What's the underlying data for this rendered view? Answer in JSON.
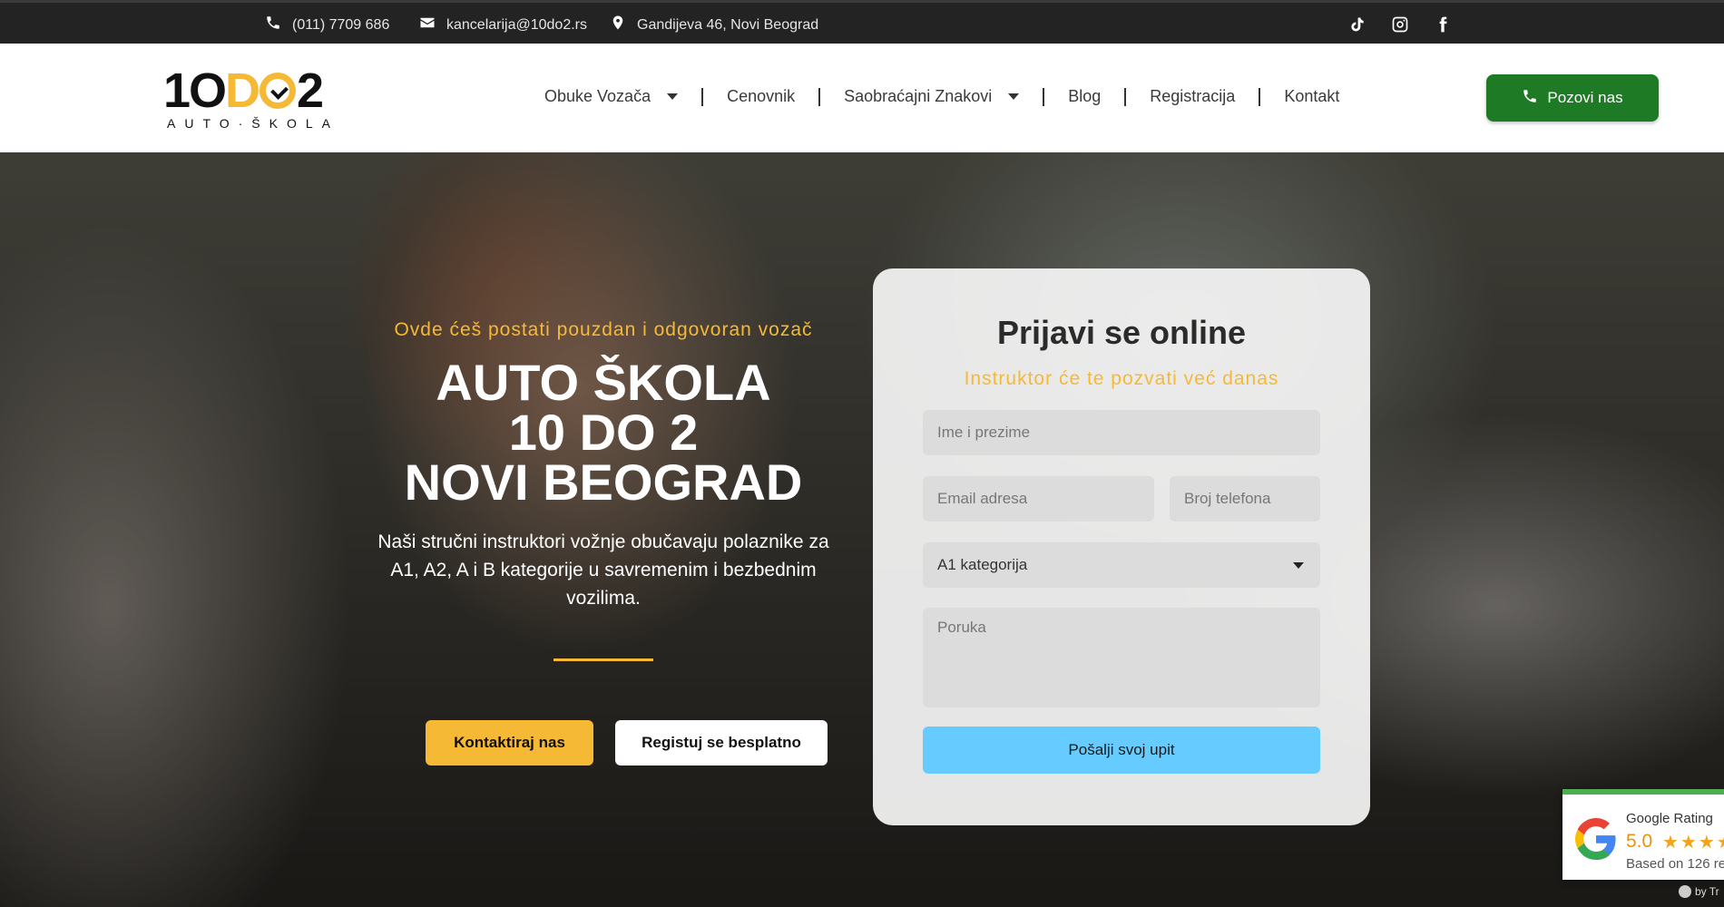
{
  "topbar": {
    "phone": "(011) 7709 686",
    "email": "kancelarija@10do2.rs",
    "address": "Gandijeva 46, Novi Beograd",
    "social": [
      "tiktok-icon",
      "instagram-icon",
      "facebook-icon"
    ]
  },
  "header": {
    "logo_main": "10DO2",
    "logo_sub": "AUTO·ŠKOLA",
    "nav": [
      "Obuke Vozača",
      "Cenovnik",
      "Saobraćajni Znakovi",
      "Blog",
      "Registracija",
      "Kontakt"
    ],
    "call_button": "Pozovi nas"
  },
  "hero": {
    "tagline": "Ovde ćeš postati pouzdan i odgovoran vozač",
    "title_line1": "AUTO ŠKOLA",
    "title_line2": "10 DO 2",
    "title_line3": "NOVI BEOGRAD",
    "lead": "Naši stručni instruktori vožnje obučavaju polaznike za A1, A2, A i B kategorije u savremenim i bezbednim vozilima.",
    "primary_button": "Kontaktiraj nas",
    "secondary_button": "Registuj se besplatno"
  },
  "form": {
    "title": "Prijavi se online",
    "subtitle": "Instruktor će te pozvati već danas",
    "name_placeholder": "Ime i prezime",
    "email_placeholder": "Email adresa",
    "phone_placeholder": "Broj telefona",
    "category_value": "A1 kategorija",
    "message_placeholder": "Poruka",
    "submit": "Pošalji svoj upit"
  },
  "rating": {
    "label": "Google Rating",
    "score": "5.0",
    "stars": "★★★★★",
    "based": "Based on 126 re",
    "byline": "by Tr"
  },
  "colors": {
    "accent": "#f6b936",
    "call_button": "#1f7a26",
    "submit": "#66ccff",
    "topbar": "#232323"
  }
}
